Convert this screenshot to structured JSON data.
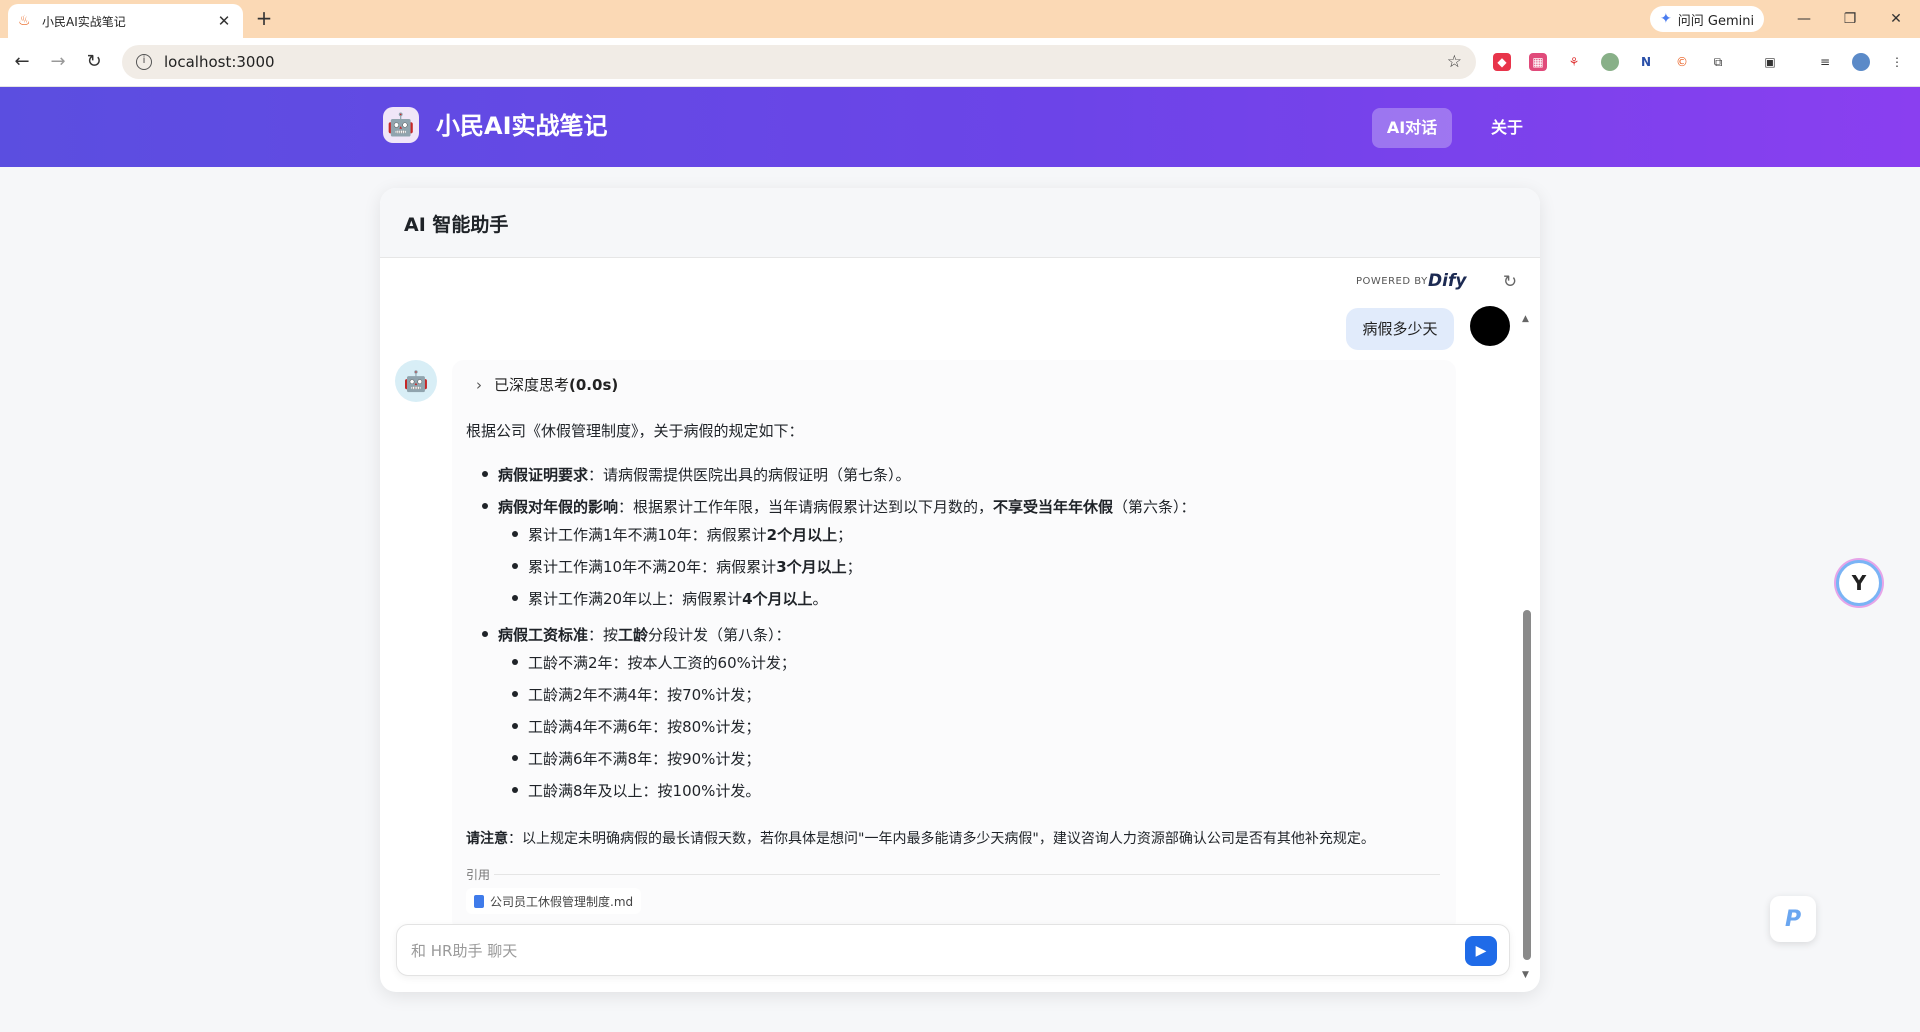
{
  "browser": {
    "tab_title": "小民AI实战笔记",
    "tab_close": "✕",
    "new_tab": "+",
    "gemini_label": "问问 Gemini",
    "url": "localhost:3000"
  },
  "header": {
    "site_title": "小民AI实战笔记",
    "nav": [
      {
        "label": "AI对话"
      },
      {
        "label": "关于"
      }
    ]
  },
  "chat": {
    "title": "AI 智能助手",
    "powered_by": "POWERED BY",
    "brand": "Dify",
    "user_message": "病假多少天",
    "think_label": "已深度思考",
    "think_time": "(0.0s)",
    "intro": "根据公司《休假管理制度》，关于病假的规定如下：",
    "items": {
      "proof_title": "病假证明要求",
      "proof_text": "：请病假需提供医院出具的病假证明（第七条）。",
      "annual_title": "病假对年假的影响",
      "annual_text": "：根据累计工作年限，当年请病假累计达到以下月数的，",
      "annual_bold": "不享受当年年休假",
      "annual_tail": "（第六条）：",
      "annual_sub": [
        {
          "text": "累计工作满1年不满10年：病假累计",
          "bold": "2个月以上",
          "tail": "；"
        },
        {
          "text": "累计工作满10年不满20年：病假累计",
          "bold": "3个月以上",
          "tail": "；"
        },
        {
          "text": "累计工作满20年以上：病假累计",
          "bold": "4个月以上",
          "tail": "。"
        }
      ],
      "wage_title": "病假工资标准",
      "wage_text": "：按",
      "wage_bold": "工龄",
      "wage_tail": "分段计发（第八条）：",
      "wage_sub": [
        "工龄不满2年：按本人工资的60%计发；",
        "工龄满2年不满4年：按70%计发；",
        "工龄满4年不满6年：按80%计发；",
        "工龄满6年不满8年：按90%计发；",
        "工龄满8年及以上：按100%计发。"
      ]
    },
    "note_title": "请注意",
    "note_text": "：以上规定未明确病假的最长请假天数，若你具体是想问\"一年内最多能请多少天病假\"，建议咨询人力资源部确认公司是否有其他补充规定。",
    "citation_label": "引用",
    "citation_file": "公司员工休假管理制度.md",
    "input_placeholder": "和 HR助手 聊天"
  }
}
